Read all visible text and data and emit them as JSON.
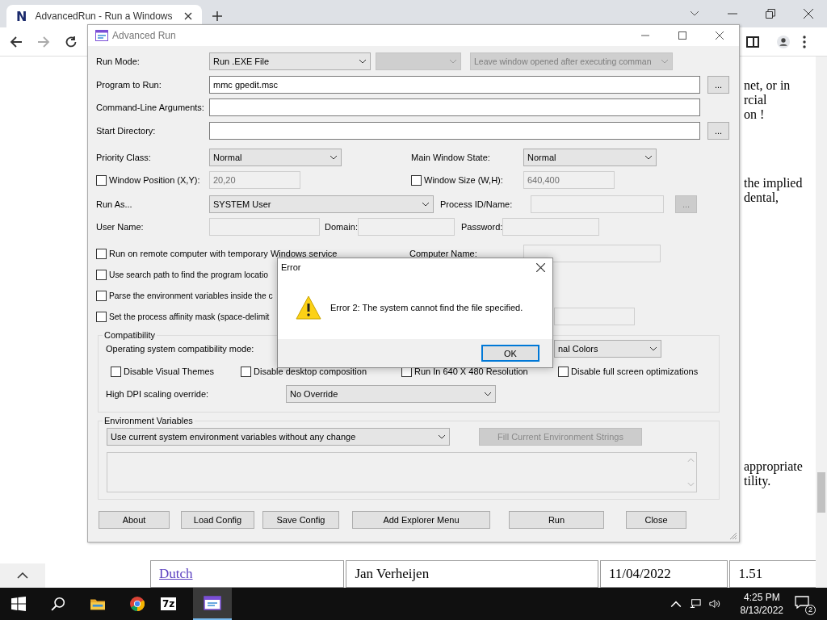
{
  "browser": {
    "favicon_letter": "N",
    "tab_title": "AdvancedRun - Run a Windows",
    "page_paragraphs": [
      [
        "net, or in",
        "rcial",
        "on !"
      ],
      [
        "the implied",
        "dental,"
      ],
      [
        "appropriate",
        "tility."
      ]
    ],
    "table": {
      "rows": [
        {
          "cells": [
            "Dutch",
            "Jan Verheijen",
            "11/04/2022",
            "1.51"
          ]
        }
      ]
    }
  },
  "window": {
    "title": "Advanced Run"
  },
  "form": {
    "run_mode": {
      "label": "Run Mode:",
      "value": "Run .EXE File"
    },
    "run_mode_2": {
      "disabled": true
    },
    "leave_window": {
      "value": "Leave window opened after executing comman",
      "disabled": true
    },
    "program": {
      "label": "Program to Run:",
      "value": "mmc gpedit.msc",
      "browse": "..."
    },
    "arguments": {
      "label": "Command-Line Arguments:"
    },
    "start_dir": {
      "label": "Start Directory:",
      "browse": "..."
    },
    "priority": {
      "label": "Priority Class:",
      "value": "Normal"
    },
    "main_window_state": {
      "label": "Main Window State:",
      "value": "Normal"
    },
    "window_position": {
      "label": "Window Position (X,Y):",
      "checked": false,
      "value": "20,20",
      "disabled": true
    },
    "window_size": {
      "label": "Window Size (W,H):",
      "checked": false,
      "value": "640,400",
      "disabled": true
    },
    "run_as": {
      "label": "Run As...",
      "value": "SYSTEM User"
    },
    "process": {
      "label": "Process ID/Name:",
      "browse": "...",
      "disabled": true
    },
    "user_name": {
      "label": "User Name:",
      "disabled": true
    },
    "domain": {
      "label": "Domain:",
      "disabled": true
    },
    "password": {
      "label": "Password:",
      "disabled": true
    },
    "options": [
      {
        "label": "Run on remote computer with temporary Windows service",
        "checked": false
      },
      {
        "label": "Use search path to find the program locatio",
        "checked": false
      },
      {
        "label": "Parse the environment variables inside the c",
        "checked": false
      },
      {
        "label": "Set the process affinity mask (space-delimit",
        "checked": false
      }
    ],
    "computer_name": {
      "label": "Computer Name:",
      "disabled": true
    },
    "affinity": {
      "disabled": true
    }
  },
  "compatibility": {
    "title": "Compatibility",
    "os_mode_label": "Operating system compatibility mode:",
    "color_mode": "nal Colors",
    "checks": [
      {
        "label": "Disable Visual Themes",
        "checked": false
      },
      {
        "label": "Disable desktop composition",
        "checked": false
      },
      {
        "label": "Run In 640 X 480 Resolution",
        "checked": false
      },
      {
        "label": "Disable full screen optimizations",
        "checked": false
      }
    ],
    "dpi_label": "High DPI scaling override:",
    "dpi_value": "No Override"
  },
  "environment": {
    "title": "Environment Variables",
    "mode": "Use current system environment variables without any change",
    "fill_button": "Fill Current Environment Strings",
    "fill_disabled": true,
    "text_disabled": true
  },
  "buttons": [
    "About",
    "Load Config",
    "Save Config",
    "Add Explorer Menu",
    "Run",
    "Close"
  ],
  "dialog": {
    "title": "Error",
    "message": "Error 2: The system cannot find the file specified.",
    "button": "OK"
  },
  "taskbar": {
    "app_label": "7z",
    "time": "4:25 PM",
    "date": "8/13/2022",
    "notifications": "2"
  }
}
